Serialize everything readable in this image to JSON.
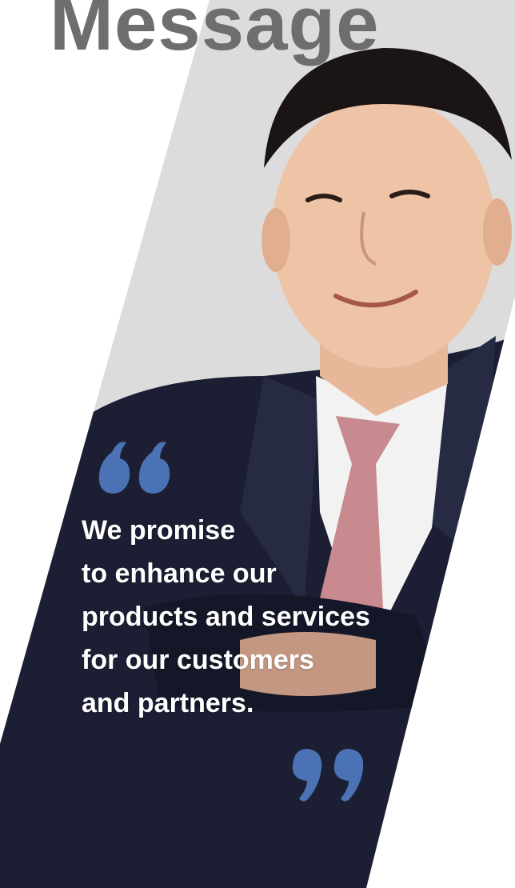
{
  "title": "Message",
  "quote": {
    "lines": [
      "We promise",
      "to enhance our",
      "products and services",
      "for our customers",
      "and partners."
    ]
  },
  "colors": {
    "title": "#6e6e6e",
    "quote_mark": "#4a72b5",
    "text": "#ffffff",
    "suit": "#1c1f33",
    "tie": "#c98a8f"
  },
  "icons": {
    "open_quote": "open-quote-icon",
    "close_quote": "close-quote-icon"
  }
}
